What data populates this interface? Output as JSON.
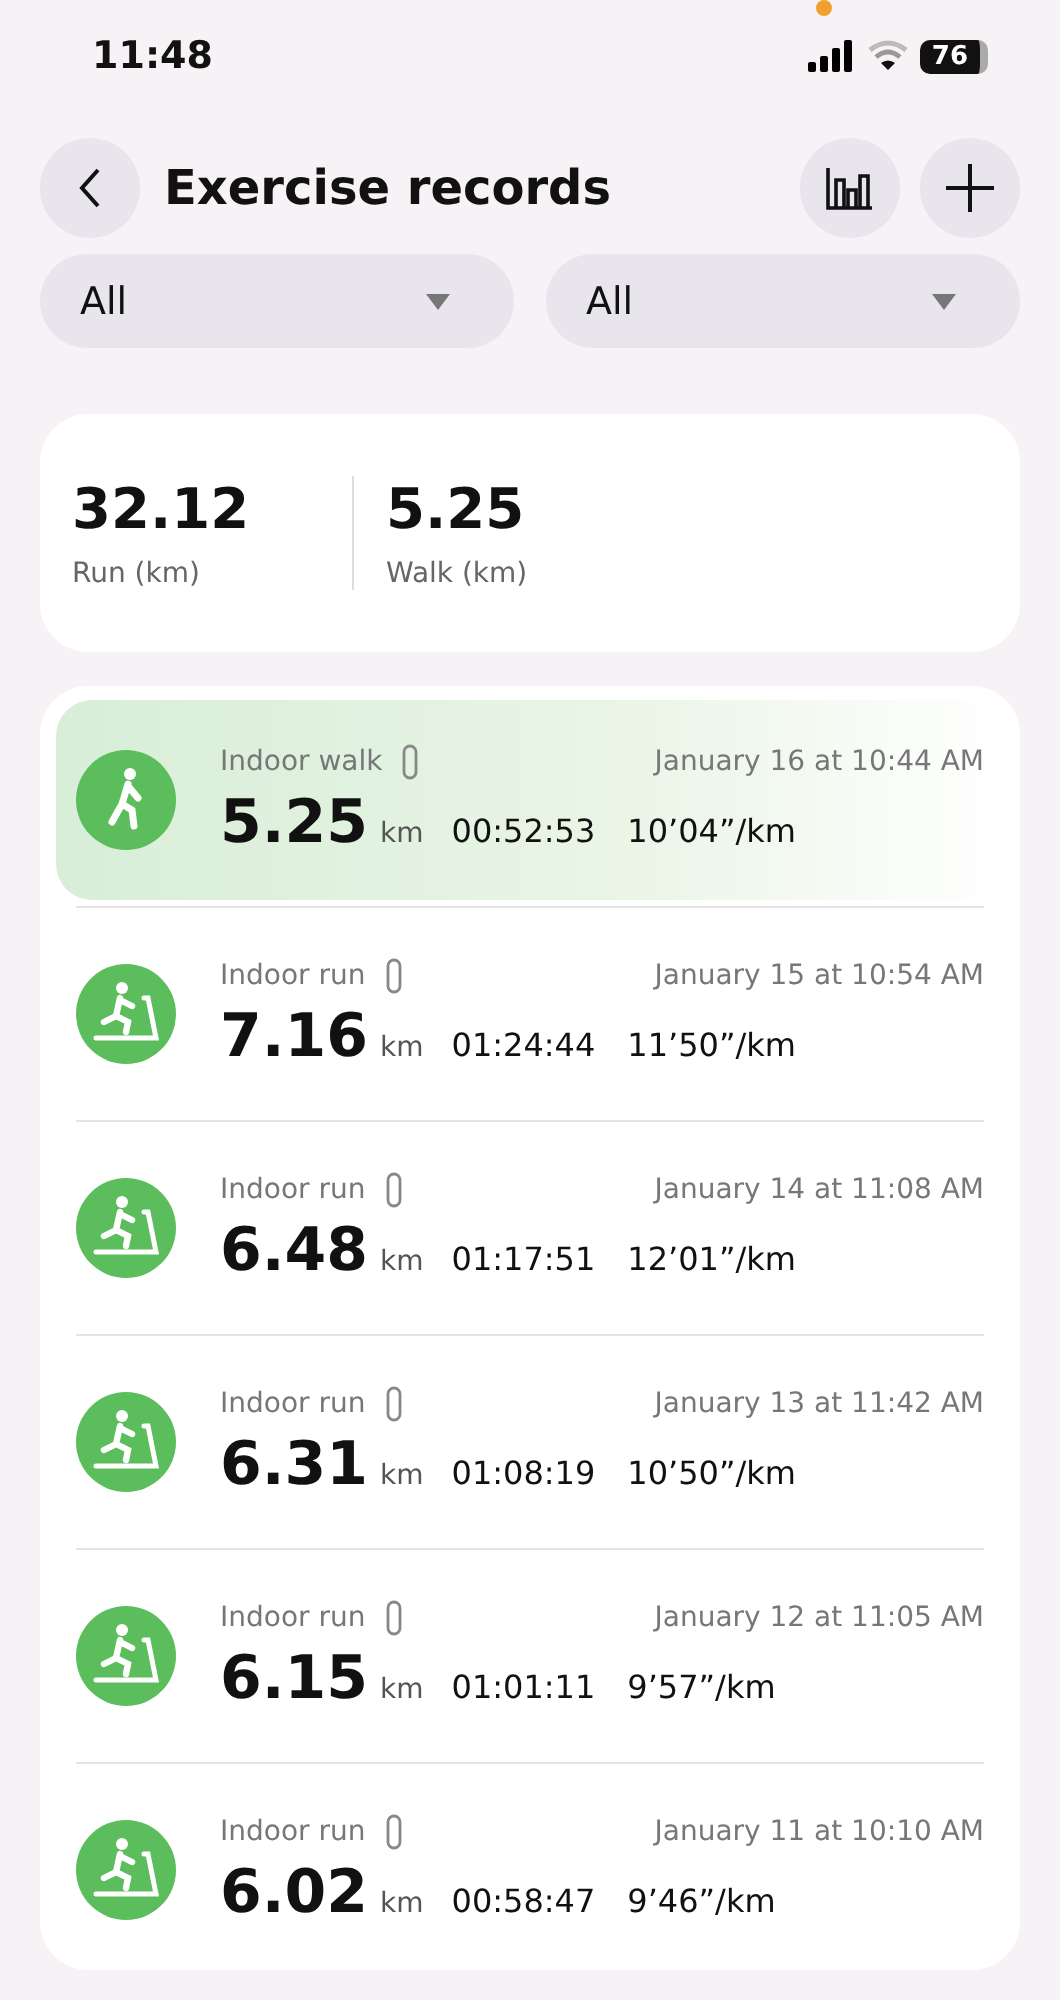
{
  "status_bar": {
    "time": "11:48",
    "battery": "76"
  },
  "header": {
    "title": "Exercise records"
  },
  "filters": [
    {
      "value": "All"
    },
    {
      "value": "All"
    }
  ],
  "summary": [
    {
      "value": "32.12",
      "label": "Run (km)"
    },
    {
      "value": "5.25",
      "label": "Walk (km)"
    }
  ],
  "records": [
    {
      "kind": "walk",
      "selected": true,
      "type": "Indoor walk",
      "date": "January 16 at 10:44 AM",
      "distance": "5.25",
      "unit": "km",
      "duration": "00:52:53",
      "pace": "10’04”/km"
    },
    {
      "kind": "run",
      "selected": false,
      "type": "Indoor run",
      "date": "January 15 at 10:54 AM",
      "distance": "7.16",
      "unit": "km",
      "duration": "01:24:44",
      "pace": "11’50”/km"
    },
    {
      "kind": "run",
      "selected": false,
      "type": "Indoor run",
      "date": "January 14 at 11:08 AM",
      "distance": "6.48",
      "unit": "km",
      "duration": "01:17:51",
      "pace": "12’01”/km"
    },
    {
      "kind": "run",
      "selected": false,
      "type": "Indoor run",
      "date": "January 13 at 11:42 AM",
      "distance": "6.31",
      "unit": "km",
      "duration": "01:08:19",
      "pace": "10’50”/km"
    },
    {
      "kind": "run",
      "selected": false,
      "type": "Indoor run",
      "date": "January 12 at 11:05 AM",
      "distance": "6.15",
      "unit": "km",
      "duration": "01:01:11",
      "pace": "9’57”/km"
    },
    {
      "kind": "run",
      "selected": false,
      "type": "Indoor run",
      "date": "January 11 at 10:10 AM",
      "distance": "6.02",
      "unit": "km",
      "duration": "00:58:47",
      "pace": "9’46”/km"
    }
  ]
}
